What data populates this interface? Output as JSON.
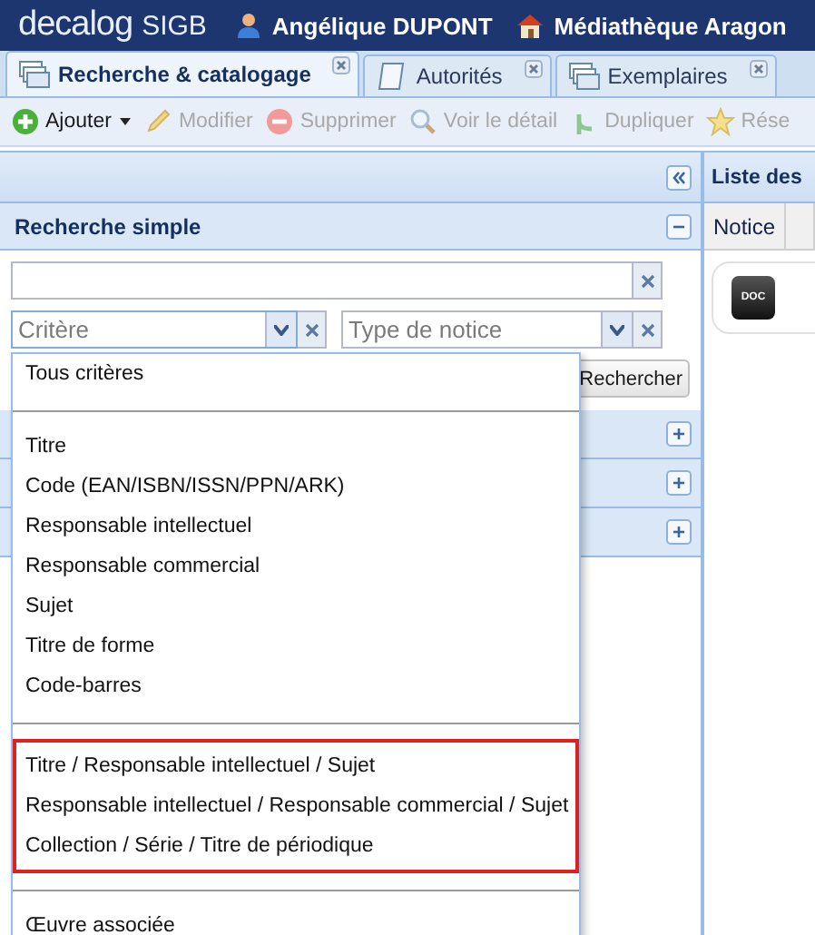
{
  "header": {
    "logo": "decalog",
    "product": "SIGB",
    "user": "Angélique DUPONT",
    "library": "Médiathèque Aragon"
  },
  "tabs": [
    {
      "label": "Recherche & catalogage",
      "selected": true
    },
    {
      "label": "Autorités",
      "selected": false
    },
    {
      "label": "Exemplaires",
      "selected": false
    }
  ],
  "toolbar": [
    {
      "label": "Ajouter",
      "disabled": false,
      "dropdown": true
    },
    {
      "label": "Modifier",
      "disabled": true,
      "dropdown": false
    },
    {
      "label": "Supprimer",
      "disabled": true,
      "dropdown": false
    },
    {
      "label": "Voir le détail",
      "disabled": true,
      "dropdown": false
    },
    {
      "label": "Dupliquer",
      "disabled": true,
      "dropdown": false
    },
    {
      "label": "Rése",
      "disabled": true,
      "dropdown": false
    }
  ],
  "search_panel": {
    "title": "Recherche simple",
    "expanded": true,
    "criterion_placeholder": "Critère",
    "type_placeholder": "Type de notice",
    "search_button": "Rechercher",
    "collapsed_sections": [
      {
        "expanded": false
      },
      {
        "expanded": false
      },
      {
        "expanded": false
      }
    ]
  },
  "criterion_dropdown": {
    "groups": [
      {
        "highlighted": false,
        "items": [
          "Tous critères"
        ]
      },
      {
        "highlighted": false,
        "items": [
          "Titre",
          "Code (EAN/ISBN/ISSN/PPN/ARK)",
          "Responsable intellectuel",
          "Responsable commercial",
          "Sujet",
          "Titre de forme",
          "Code-barres"
        ]
      },
      {
        "highlighted": true,
        "items": [
          "Titre / Responsable intellectuel / Sujet",
          "Responsable intellectuel / Responsable commercial / Sujet",
          "Collection / Série / Titre de périodique"
        ]
      },
      {
        "highlighted": false,
        "items": [
          "Œuvre associée"
        ]
      }
    ]
  },
  "results_panel": {
    "title": "Liste des",
    "columns": [
      "Notice"
    ],
    "badge": "DOC"
  }
}
